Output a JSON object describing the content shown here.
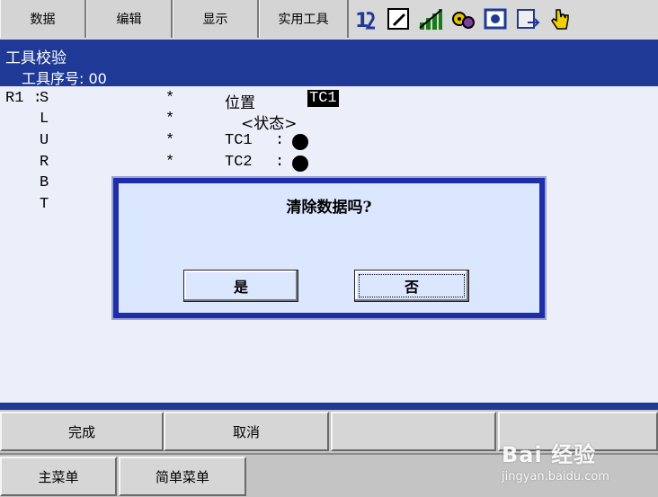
{
  "menu": [
    "数据",
    "编辑",
    "显示",
    "实用工具"
  ],
  "toolbar_icons": [
    "step-icon",
    "edit-note-icon",
    "signal-icon",
    "gear-icon",
    "frame-icon",
    "export-icon",
    "hand-icon"
  ],
  "title": {
    "name": "工具校验",
    "tool_no_label": "工具序号",
    "tool_no_value": "00"
  },
  "axes": {
    "robot": "R1 :",
    "labels": [
      "S",
      "L",
      "U",
      "R",
      "B",
      "T"
    ],
    "marks": [
      "*",
      "*",
      "*",
      "*"
    ]
  },
  "position": {
    "label": "位置",
    "value": "TC1",
    "status_label": "<状态>",
    "items": [
      "TC1",
      "TC2"
    ],
    "colon": ":"
  },
  "dialog": {
    "message": "清除数据吗?",
    "yes": "是",
    "no": "否"
  },
  "function_keys": [
    "完成",
    "取消",
    "",
    ""
  ],
  "main_keys": [
    "主菜单",
    "简单菜单"
  ],
  "watermark": {
    "brand": "Bai 经验",
    "url": "jingyan.baidu.com"
  }
}
